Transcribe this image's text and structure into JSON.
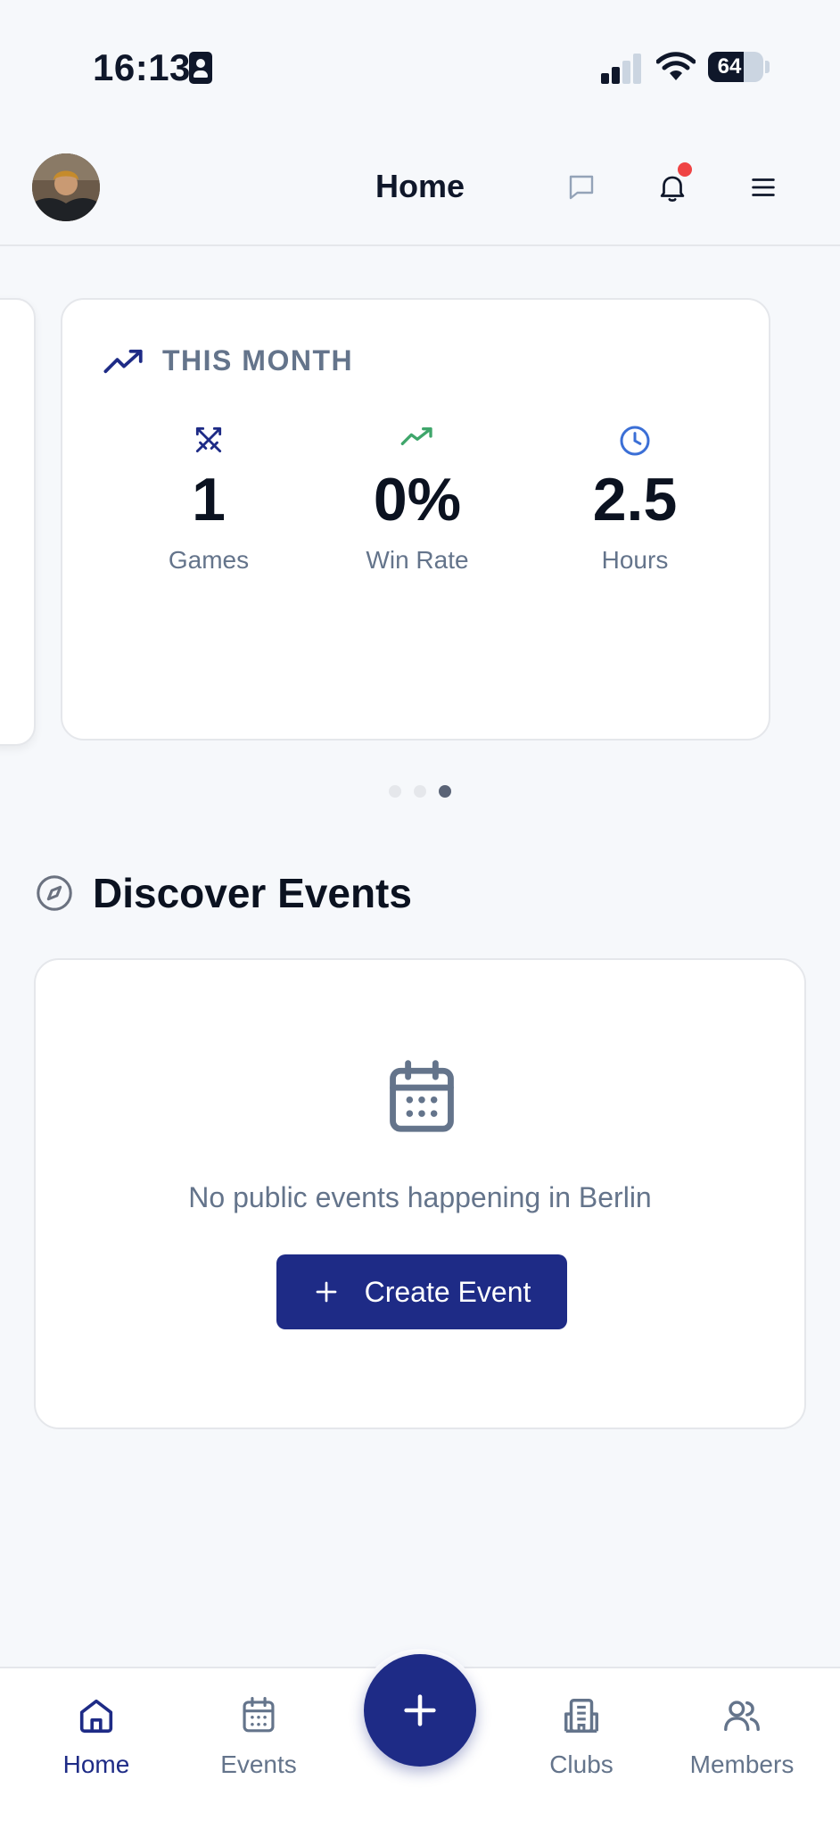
{
  "status_bar": {
    "time": "16:13",
    "battery": "64",
    "battery_level": 0.64
  },
  "header": {
    "title": "Home",
    "avatar_icon": "user-avatar-photo",
    "chat_icon": "chat-bubble-icon",
    "bell_icon": "bell-icon",
    "menu_icon": "hamburger-menu-icon",
    "has_notification": true
  },
  "stats_card": {
    "title": "THIS MONTH",
    "title_icon": "trending-up-icon",
    "stats": [
      {
        "icon": "crossed-swords-icon",
        "value": "1",
        "label": "Games"
      },
      {
        "icon": "trending-up-icon",
        "value": "0%",
        "label": "Win Rate"
      },
      {
        "icon": "clock-icon",
        "value": "2.5",
        "label": "Hours"
      }
    ],
    "carousel": {
      "pages": 3,
      "active_index": 2
    }
  },
  "discover": {
    "title": "Discover Events",
    "icon": "compass-icon",
    "empty_icon": "calendar-icon",
    "empty_text": "No public events happening in Berlin",
    "create_button": "Create Event"
  },
  "bottom_nav": {
    "items": [
      {
        "label": "Home",
        "icon": "home-icon",
        "active": true
      },
      {
        "label": "Events",
        "icon": "calendar-icon",
        "active": false
      },
      {
        "label": "Clubs",
        "icon": "building-icon",
        "active": false
      },
      {
        "label": "Members",
        "icon": "users-icon",
        "active": false
      }
    ],
    "fab_icon": "plus-icon"
  },
  "colors": {
    "primary": "#1e2b86",
    "background": "#f6f8fb",
    "muted_text": "#64748b",
    "notification": "#ef4444",
    "win_rate_accent": "#3fa66b",
    "clock_accent": "#3b6fd6"
  }
}
